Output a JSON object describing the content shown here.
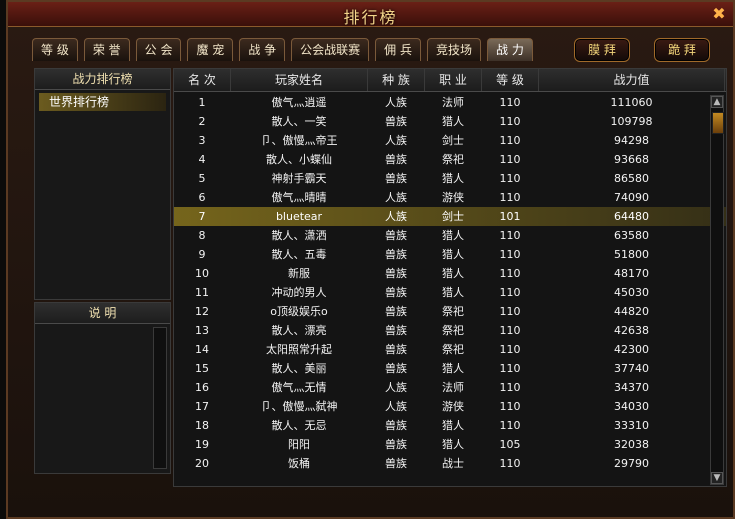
{
  "window": {
    "title": "排行榜",
    "close_glyph": "✖"
  },
  "tabs": [
    {
      "label": "等 级",
      "active": false
    },
    {
      "label": "荣 誉",
      "active": false
    },
    {
      "label": "公 会",
      "active": false
    },
    {
      "label": "魔 宠",
      "active": false
    },
    {
      "label": "战 争",
      "active": false
    },
    {
      "label": "公会战联赛",
      "active": false
    },
    {
      "label": "佣 兵",
      "active": false
    },
    {
      "label": "竞技场",
      "active": false
    },
    {
      "label": "战 力",
      "active": true
    }
  ],
  "actions": {
    "mo_bai": "膜 拜",
    "tiao_bai": "跪 拜"
  },
  "left_panel": {
    "header": "战力排行榜",
    "selected_item": "世界排行榜"
  },
  "desc_panel": {
    "header": "说  明"
  },
  "table": {
    "columns": [
      "名 次",
      "玩家姓名",
      "种 族",
      "职 业",
      "等 级",
      "战力值"
    ],
    "rows": [
      {
        "rank": "1",
        "name": "傲气灬逍遥",
        "race": "人族",
        "class": "法师",
        "level": "110",
        "power": "111060"
      },
      {
        "rank": "2",
        "name": "散人、一笑",
        "race": "兽族",
        "class": "猎人",
        "level": "110",
        "power": "109798"
      },
      {
        "rank": "3",
        "name": "卩、傲慢灬帝王",
        "race": "人族",
        "class": "剑士",
        "level": "110",
        "power": "94298"
      },
      {
        "rank": "4",
        "name": "散人、小蝶仙",
        "race": "兽族",
        "class": "祭祀",
        "level": "110",
        "power": "93668"
      },
      {
        "rank": "5",
        "name": "神射手霸天",
        "race": "兽族",
        "class": "猎人",
        "level": "110",
        "power": "86580"
      },
      {
        "rank": "6",
        "name": "傲气灬晴晴",
        "race": "人族",
        "class": "游侠",
        "level": "110",
        "power": "74090"
      },
      {
        "rank": "7",
        "name": "bluetear",
        "race": "人族",
        "class": "剑士",
        "level": "101",
        "power": "64480",
        "selected": true
      },
      {
        "rank": "8",
        "name": "散人、潇洒",
        "race": "兽族",
        "class": "猎人",
        "level": "110",
        "power": "63580"
      },
      {
        "rank": "9",
        "name": "散人、五毒",
        "race": "兽族",
        "class": "猎人",
        "level": "110",
        "power": "51800"
      },
      {
        "rank": "10",
        "name": "新服",
        "race": "兽族",
        "class": "猎人",
        "level": "110",
        "power": "48170"
      },
      {
        "rank": "11",
        "name": "冲动的男人",
        "race": "兽族",
        "class": "猎人",
        "level": "110",
        "power": "45030"
      },
      {
        "rank": "12",
        "name": "o顶级娱乐o",
        "race": "兽族",
        "class": "祭祀",
        "level": "110",
        "power": "44820"
      },
      {
        "rank": "13",
        "name": "散人、漂亮",
        "race": "兽族",
        "class": "祭祀",
        "level": "110",
        "power": "42638"
      },
      {
        "rank": "14",
        "name": "太阳照常升起",
        "race": "兽族",
        "class": "祭祀",
        "level": "110",
        "power": "42300"
      },
      {
        "rank": "15",
        "name": "散人、美丽",
        "race": "兽族",
        "class": "猎人",
        "level": "110",
        "power": "37740"
      },
      {
        "rank": "16",
        "name": "傲气灬无情",
        "race": "人族",
        "class": "法师",
        "level": "110",
        "power": "34370"
      },
      {
        "rank": "17",
        "name": "卩、傲慢灬弑神",
        "race": "人族",
        "class": "游侠",
        "level": "110",
        "power": "34030"
      },
      {
        "rank": "18",
        "name": "散人、无忌",
        "race": "兽族",
        "class": "猎人",
        "level": "110",
        "power": "33310"
      },
      {
        "rank": "19",
        "name": "阳阳",
        "race": "兽族",
        "class": "猎人",
        "level": "105",
        "power": "32038"
      },
      {
        "rank": "20",
        "name": "饭桶",
        "race": "兽族",
        "class": "战士",
        "level": "110",
        "power": "29790"
      }
    ]
  },
  "icons": {
    "up": "▲",
    "down": "▼"
  }
}
